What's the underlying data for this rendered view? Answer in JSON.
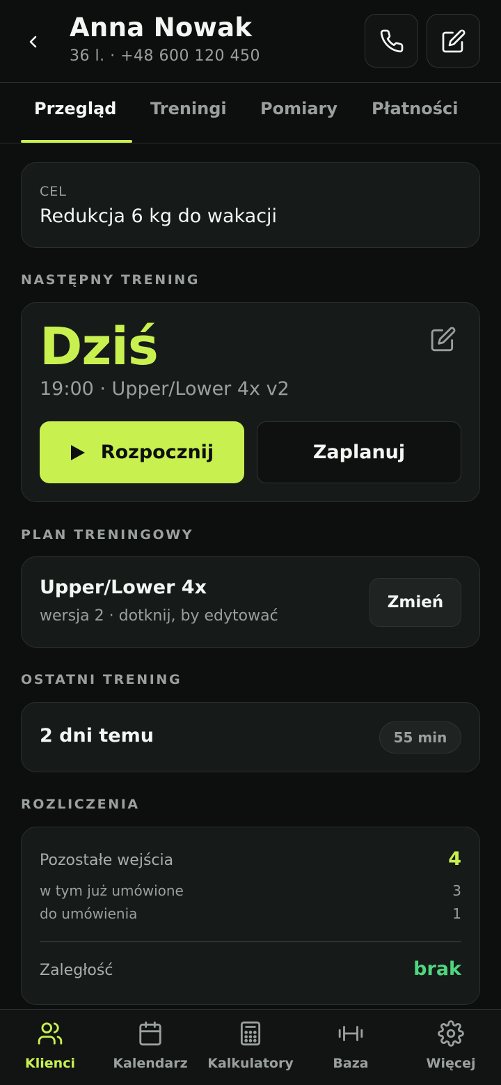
{
  "header": {
    "name": "Anna Nowak",
    "subtitle": "36 l. · +48 600 120 450",
    "icons": {
      "back": "chevron-left-icon",
      "call": "phone-icon",
      "edit": "edit-icon"
    }
  },
  "tabs": [
    {
      "label": "Przegląd",
      "active": true
    },
    {
      "label": "Treningi",
      "active": false
    },
    {
      "label": "Pomiary",
      "active": false
    },
    {
      "label": "Płatności",
      "active": false
    }
  ],
  "goal": {
    "label": "CEL",
    "text": "Redukcja 6 kg do wakacji"
  },
  "next_training": {
    "section_label": "NASTĘPNY TRENING",
    "day": "Dziś",
    "details": "19:00 · Upper/Lower 4x v2",
    "start_label": "Rozpocznij",
    "schedule_label": "Zaplanuj"
  },
  "plan": {
    "section_label": "PLAN TRENINGOWY",
    "name": "Upper/Lower 4x",
    "subtitle": "wersja 2 · dotknij, by edytować",
    "change_label": "Zmień"
  },
  "last_training": {
    "section_label": "OSTATNI TRENING",
    "when": "2 dni temu",
    "duration": "55 min"
  },
  "billing": {
    "section_label": "ROZLICZENIA",
    "remaining_label": "Pozostałe wejścia",
    "remaining_value": "4",
    "booked_label": "w tym już umówione",
    "booked_value": "3",
    "to_book_label": "do umówienia",
    "to_book_value": "1",
    "arrears_label": "Zaległość",
    "arrears_value": "brak"
  },
  "bottom_nav": [
    {
      "label": "Klienci",
      "icon": "users-icon",
      "active": true
    },
    {
      "label": "Kalendarz",
      "icon": "calendar-icon",
      "active": false
    },
    {
      "label": "Kalkulatory",
      "icon": "calculator-icon",
      "active": false
    },
    {
      "label": "Baza",
      "icon": "dumbbell-icon",
      "active": false
    },
    {
      "label": "Więcej",
      "icon": "gear-icon",
      "active": false
    }
  ],
  "colors": {
    "background": "#0d0f0f",
    "card": "#161a19",
    "accent": "#c8f150",
    "success": "#4fd67f",
    "muted_text": "#9aa09d"
  }
}
